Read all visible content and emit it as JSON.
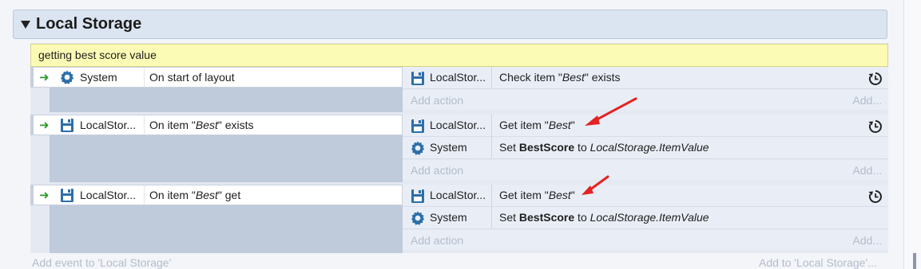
{
  "group": {
    "title": "Local Storage"
  },
  "comment": {
    "text": "getting best score value"
  },
  "events": [
    {
      "condition": {
        "object": "System",
        "icon": "gear-icon",
        "text": "On start of layout"
      },
      "actions": [
        {
          "object": "LocalStor...",
          "icon": "local-storage-icon",
          "pre": "Check item \"",
          "italic": "Best",
          "post": "\" exists"
        }
      ]
    },
    {
      "condition": {
        "object": "LocalStor...",
        "icon": "local-storage-icon",
        "pre": "On item \"",
        "italic": "Best",
        "post": "\" exists"
      },
      "actions": [
        {
          "object": "LocalStor...",
          "icon": "local-storage-icon",
          "pre": "Get item \"",
          "italic": "Best",
          "post": "\""
        },
        {
          "object": "System",
          "icon": "gear-icon",
          "pre": "Set ",
          "bold": "BestScore",
          "mid": " to ",
          "italic": "LocalStorage.ItemValue"
        }
      ]
    },
    {
      "condition": {
        "object": "LocalStor...",
        "icon": "local-storage-icon",
        "pre": "On item \"",
        "italic": "Best",
        "post": "\" get"
      },
      "actions": [
        {
          "object": "LocalStor...",
          "icon": "local-storage-icon",
          "pre": "Get item \"",
          "italic": "Best",
          "post": "\""
        },
        {
          "object": "System",
          "icon": "gear-icon",
          "pre": "Set ",
          "bold": "BestScore",
          "mid": " to ",
          "italic": "LocalStorage.ItemValue"
        }
      ]
    }
  ],
  "labels": {
    "add_action": "Add action",
    "add_more": "Add...",
    "add_event": "Add event to 'Local Storage'",
    "add_to": "Add to 'Local Storage'..."
  },
  "colors": {
    "accent_arrow": "#e32222",
    "condition_arrow": "#2f9a2f",
    "comment_bg": "#fbfbb5",
    "group_bg": "#dbe4f1"
  }
}
